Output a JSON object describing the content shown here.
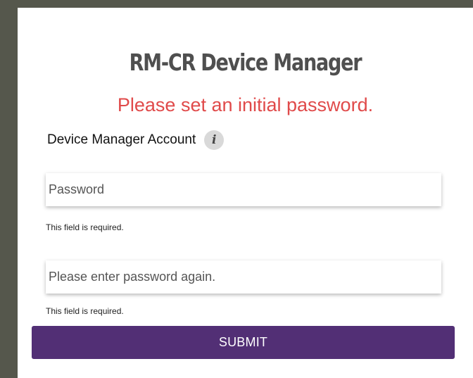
{
  "header": {
    "title": "RM-CR Device Manager",
    "subtitle": "Please set an initial password."
  },
  "account": {
    "label": "Device Manager Account",
    "info_icon": "info-icon"
  },
  "form": {
    "password": {
      "value": "",
      "placeholder": "Password",
      "error": "This field is required."
    },
    "confirm": {
      "value": "",
      "placeholder": "Please enter password again.",
      "error": "This field is required."
    },
    "submit_label": "SUBMIT"
  },
  "colors": {
    "background": "#55574c",
    "title": "#4f4f4f",
    "alert": "#e04a4a",
    "button": "#522f75"
  }
}
